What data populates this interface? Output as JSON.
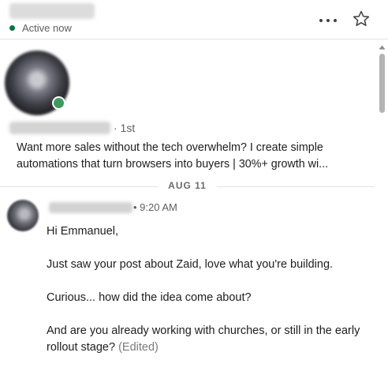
{
  "header": {
    "status": "Active now",
    "status_color": "#057642",
    "more_icon": "more-horizontal-icon",
    "star_icon": "star-outline-icon"
  },
  "profile": {
    "degree": "· 1st",
    "headline": "Want more sales without the tech overwhelm? I create simple automations that turn browsers into buyers | 30%+ growth wi..."
  },
  "divider": {
    "date": "AUG 11"
  },
  "message": {
    "time": "• 9:20 AM",
    "lines": [
      "Hi Emmanuel,",
      "Just saw your post about Zaid, love what you're building.",
      "Curious... how did the idea come about?",
      "And are you already working with churches, or still in the early rollout stage?"
    ],
    "edited_label": "(Edited)"
  }
}
